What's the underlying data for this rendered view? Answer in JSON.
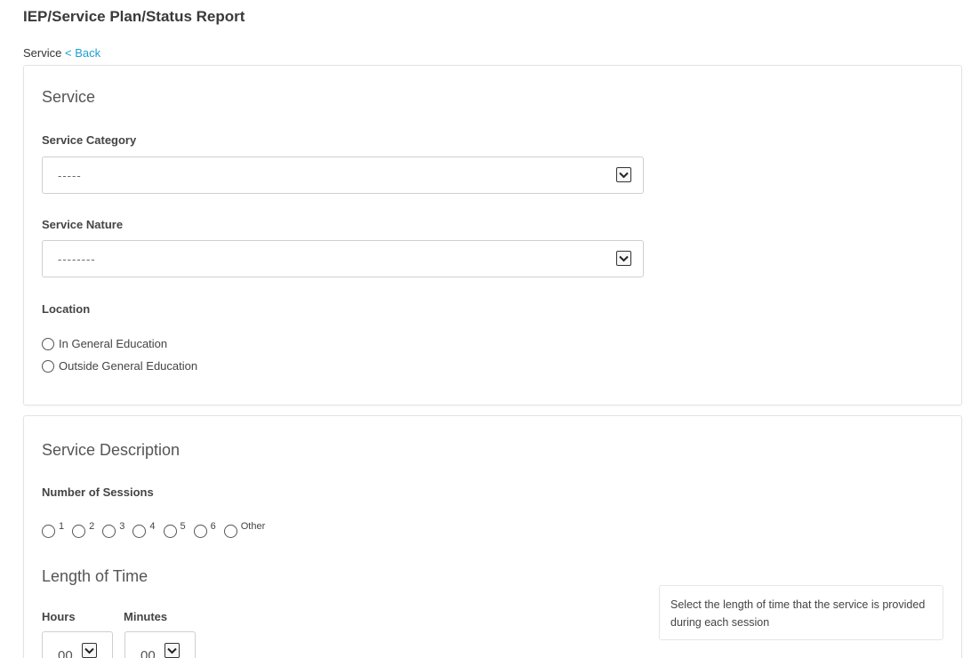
{
  "page_title": "IEP/Service Plan/Status Report",
  "breadcrumb": {
    "current": "Service",
    "back": "< Back"
  },
  "service": {
    "heading": "Service",
    "category_label": "Service Category",
    "category_value": "-----",
    "nature_label": "Service Nature",
    "nature_value": "--------",
    "location_label": "Location",
    "location_options": [
      "In General Education",
      "Outside General Education"
    ]
  },
  "description": {
    "heading": "Service Description",
    "sessions_label": "Number of Sessions",
    "session_options": [
      "1",
      "2",
      "3",
      "4",
      "5",
      "6",
      "Other"
    ],
    "length_heading": "Length of Time",
    "hours_label": "Hours",
    "hours_value": "00",
    "minutes_label": "Minutes",
    "minutes_value": "00",
    "help_text": "Select the length of time that the service is provided during each session"
  },
  "icons": {
    "select_arrow": "chevron-down-icon",
    "radio": "radio-circle"
  }
}
